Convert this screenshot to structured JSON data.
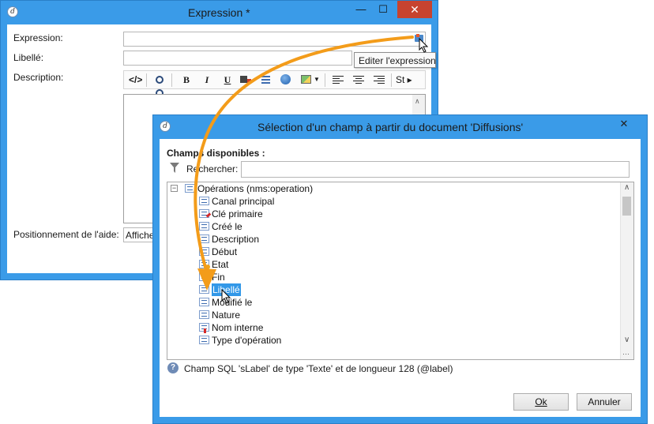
{
  "expression_window": {
    "title": "Expression *",
    "minimize_glyph": "—",
    "maximize_glyph": "☐",
    "close_glyph": "✕",
    "expression_label": "Expression:",
    "label_label": "Libellé:",
    "description_label": "Description:",
    "help_position_label": "Positionnement de l'aide:",
    "help_position_value": "Affiche",
    "tooltip": "Editer l'expression",
    "toolbar": {
      "bold": "B",
      "italic": "I",
      "underline": "U",
      "style": "St ▸"
    }
  },
  "selection_dialog": {
    "title": "Sélection d'un champ à partir du document 'Diffusions'",
    "close_glyph": "✕",
    "minimize_glyph": "—",
    "maximize_glyph": "☐",
    "available_fields_label": "Champs disponibles :",
    "search_label": "Rechercher:",
    "search_value": "",
    "tree_root": "Opérations (nms:operation)",
    "tree_collapse_glyph": "−",
    "tree_items": [
      "Canal principal",
      "Clé primaire",
      "Créé le",
      "Description",
      "Début",
      "Etat",
      "Fin",
      "Libellé",
      "Modifié le",
      "Nature",
      "Nom interne",
      "Type d'opération"
    ],
    "selected_item": "Libellé",
    "info_text": "Champ SQL 'sLabel' de type 'Texte' et de longueur 128 (@label)",
    "ok_label": "Ok",
    "cancel_label": "Annuler",
    "scroll_up_glyph": "∧",
    "scroll_down_glyph": "∨",
    "more_glyph": "···"
  },
  "colors": {
    "window_frame": "#3a9be8",
    "close_button": "#c7432f",
    "selection": "#3298e8",
    "annotation_arrow": "#f39c1a"
  }
}
